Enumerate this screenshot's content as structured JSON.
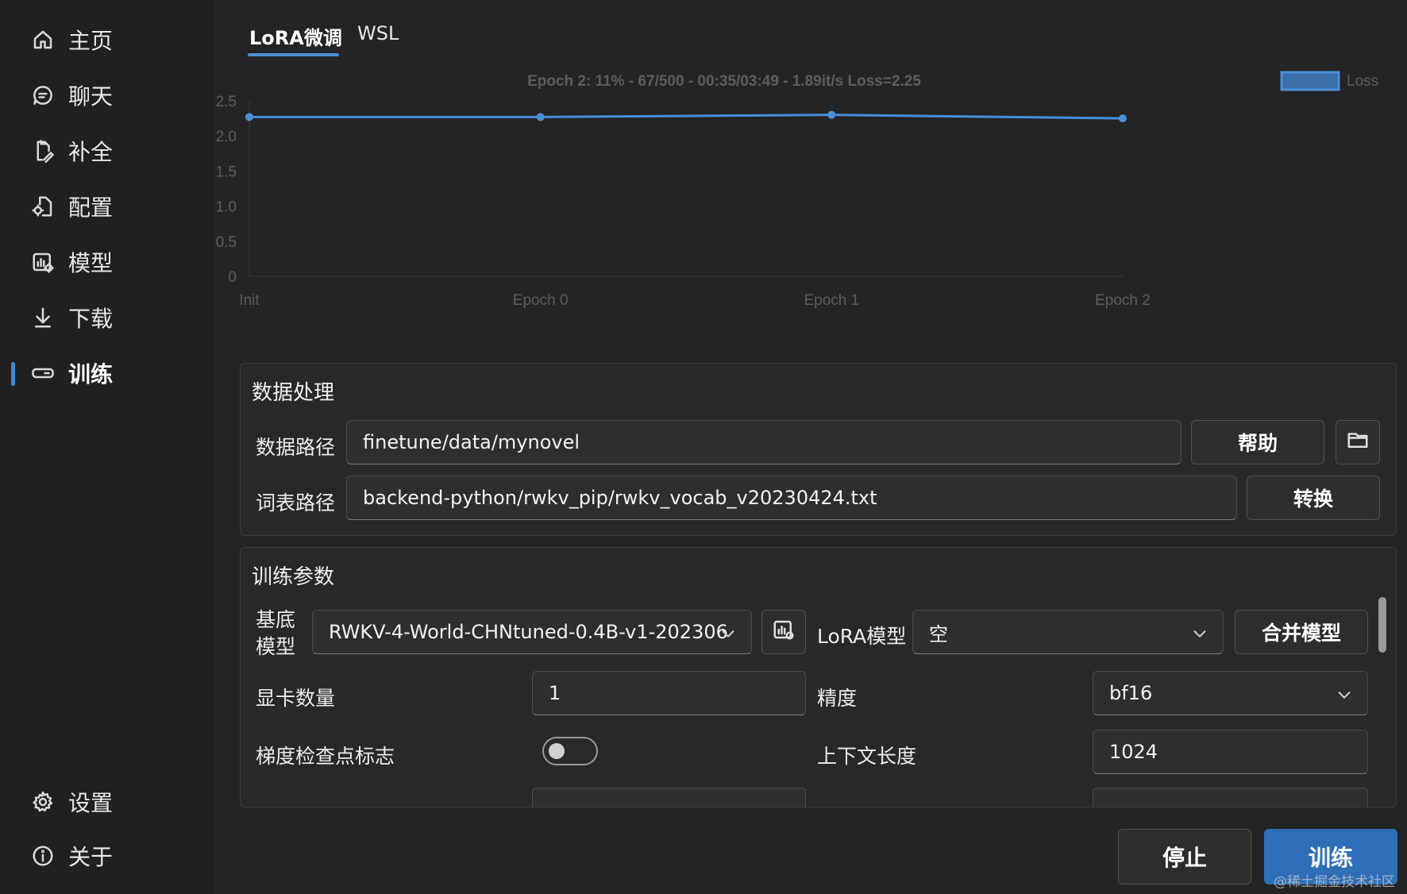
{
  "sidebar": {
    "items": [
      {
        "label": "主页",
        "icon": "home-icon"
      },
      {
        "label": "聊天",
        "icon": "chat-icon"
      },
      {
        "label": "补全",
        "icon": "completion-icon"
      },
      {
        "label": "配置",
        "icon": "config-icon"
      },
      {
        "label": "模型",
        "icon": "model-icon"
      },
      {
        "label": "下载",
        "icon": "download-icon"
      },
      {
        "label": "训练",
        "icon": "train-icon",
        "active": true
      }
    ],
    "bottom_items": [
      {
        "label": "设置",
        "icon": "gear-icon"
      },
      {
        "label": "关于",
        "icon": "info-icon"
      }
    ]
  },
  "tabs": [
    {
      "label": "LoRA微调",
      "active": true
    },
    {
      "label": "WSL",
      "active": false
    }
  ],
  "chart_data": {
    "type": "line",
    "title": "Epoch 2: 11% - 67/500 - 00:35/03:49 - 1.89it/s Loss=2.25",
    "categories": [
      "Init",
      "Epoch 0",
      "Epoch 1",
      "Epoch 2"
    ],
    "series": [
      {
        "name": "Loss",
        "values": [
          2.27,
          2.27,
          2.3,
          2.25
        ],
        "color": "#4a90d9"
      }
    ],
    "yticks": [
      "0",
      "0.5",
      "1.0",
      "1.5",
      "2.0",
      "2.5"
    ],
    "ylim": [
      0,
      2.5
    ],
    "legend": "top-right",
    "grid": false
  },
  "data_panel": {
    "title": "数据处理",
    "data_path_label": "数据路径",
    "data_path_value": "finetune/data/mynovel",
    "help_button": "帮助",
    "vocab_path_label": "词表路径",
    "vocab_path_value": "backend-python/rwkv_pip/rwkv_vocab_v20230424.txt",
    "convert_button": "转换"
  },
  "train_panel": {
    "title": "训练参数",
    "base_model_label": "基底\n模型",
    "base_model_value": "RWKV-4-World-CHNtuned-0.4B-v1-202306",
    "lora_model_label": "LoRA模型",
    "lora_model_value": "空",
    "merge_button": "合并模型",
    "gpu_count_label": "显卡数量",
    "gpu_count_value": "1",
    "precision_label": "精度",
    "precision_value": "bf16",
    "grad_cp_label": "梯度检查点标志",
    "grad_cp_on": false,
    "ctx_len_label": "上下文长度",
    "ctx_len_value": "1024"
  },
  "actions": {
    "stop_label": "停止",
    "train_label": "训练"
  },
  "watermark": "@稀土掘金技术社区"
}
